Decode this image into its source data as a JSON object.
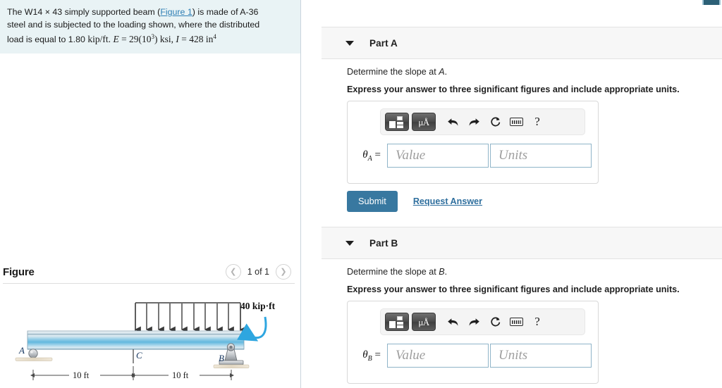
{
  "problem": {
    "line1_a": "The W14 ",
    "line1_times": "×",
    "line1_b": " 43 simply supported beam (",
    "figure_link": "Figure 1",
    "line1_c": ") is made of A-36",
    "line2": "steel and is subjected to the loading shown, where the distributed",
    "line3_a": "load is equal to 1.80 ",
    "line3_kip": "kip/ft.",
    "line3_E": "E",
    "line3_eq1": " = 29(10",
    "line3_exp1": "3",
    "line3_eq2": ") ksi, ",
    "line3_I": "I",
    "line3_eq3": " = 428 in",
    "line3_exp2": "4"
  },
  "figure": {
    "title": "Figure",
    "counter": "1 of 1",
    "prev_icon": "chevron-left-icon",
    "next_icon": "chevron-right-icon",
    "diagram": {
      "label_A": "A",
      "label_B": "B",
      "label_C": "C",
      "moment_label": "40 kip·ft",
      "dim_left": "10 ft",
      "dim_right": "10 ft",
      "distributed_arrow_count": 10,
      "beam_color": "#5cb0d8",
      "moment_arrow_color": "#2ea6e0",
      "support_color": "#b9bcc0"
    }
  },
  "parts": [
    {
      "header_label": "Part A",
      "caret_icon": "caret-down-icon",
      "prompt_prefix": "Determine the slope at ",
      "prompt_var": "A",
      "prompt_suffix": ".",
      "instruction": "Express your answer to three significant figures and include appropriate units.",
      "toolbar": {
        "template_icon": "math-template-icon",
        "units_icon": "micro-angstrom-units-icon",
        "undo_icon": "undo-arrow-icon",
        "redo_icon": "redo-arrow-icon",
        "reset_icon": "reset-circle-arrow-icon",
        "keyboard_icon": "keyboard-icon",
        "help_icon": "question-mark-icon"
      },
      "answer": {
        "label_symbol": "θ",
        "label_sub": "A",
        "label_eq": " =",
        "value_placeholder": "Value",
        "units_placeholder": "Units"
      },
      "submit_label": "Submit",
      "request_answer_label": "Request Answer"
    },
    {
      "header_label": "Part B",
      "caret_icon": "caret-down-icon",
      "prompt_prefix": "Determine the slope at ",
      "prompt_var": "B",
      "prompt_suffix": ".",
      "instruction": "Express your answer to three significant figures and include appropriate units.",
      "toolbar": {
        "template_icon": "math-template-icon",
        "units_icon": "micro-angstrom-units-icon",
        "undo_icon": "undo-arrow-icon",
        "redo_icon": "redo-arrow-icon",
        "reset_icon": "reset-circle-arrow-icon",
        "keyboard_icon": "keyboard-icon",
        "help_icon": "question-mark-icon"
      },
      "answer": {
        "label_symbol": "θ",
        "label_sub": "B",
        "label_eq": " =",
        "value_placeholder": "Value",
        "units_placeholder": "Units"
      }
    }
  ],
  "colors": {
    "accent": "#3878a0",
    "link": "#2f6f9e",
    "problem_bg": "#e9f3f5",
    "part_header_bg": "#f7f7f7"
  }
}
